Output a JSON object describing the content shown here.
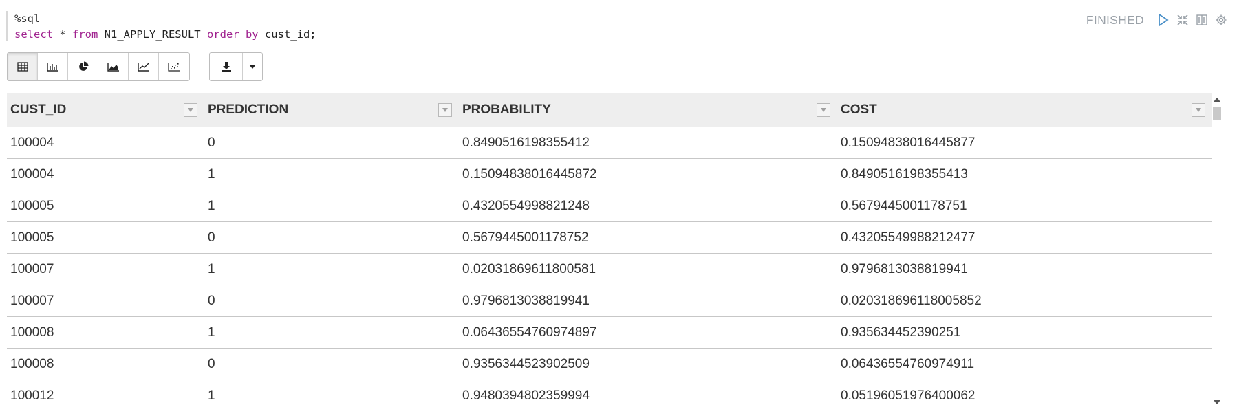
{
  "editor": {
    "line1": "%sql",
    "line2": {
      "kw1": "select",
      "p1": " * ",
      "kw2": "from",
      "p2": " N1_APPLY_RESULT ",
      "kw3": "order by",
      "p3": " cust_id;"
    }
  },
  "status": {
    "text": "FINISHED",
    "icons": [
      "run-icon",
      "collapse-icon",
      "book-icon",
      "gear-icon"
    ]
  },
  "toolbar": {
    "views": [
      "table-view-icon",
      "bar-chart-icon",
      "pie-chart-icon",
      "area-chart-icon",
      "line-chart-icon",
      "scatter-chart-icon"
    ],
    "active_view": "table-view-icon",
    "download": [
      "download-icon",
      "caret-down-icon"
    ]
  },
  "table": {
    "columns": [
      "CUST_ID",
      "PREDICTION",
      "PROBABILITY",
      "COST"
    ],
    "rows": [
      [
        "100004",
        "0",
        "0.8490516198355412",
        "0.15094838016445877"
      ],
      [
        "100004",
        "1",
        "0.15094838016445872",
        "0.8490516198355413"
      ],
      [
        "100005",
        "1",
        "0.4320554998821248",
        "0.5679445001178751"
      ],
      [
        "100005",
        "0",
        "0.5679445001178752",
        "0.43205549988212477"
      ],
      [
        "100007",
        "1",
        "0.02031869611800581",
        "0.9796813038819941"
      ],
      [
        "100007",
        "0",
        "0.9796813038819941",
        "0.020318696118005852"
      ],
      [
        "100008",
        "1",
        "0.06436554760974897",
        "0.935634452390251"
      ],
      [
        "100008",
        "0",
        "0.9356344523902509",
        "0.06436554760974911"
      ],
      [
        "100012",
        "1",
        "0.9480394802359994",
        "0.05196051976400062"
      ]
    ]
  },
  "colors": {
    "keyword": "#a0228f",
    "header_bg": "#eeeeee",
    "status_grey": "#9aa1a8"
  }
}
